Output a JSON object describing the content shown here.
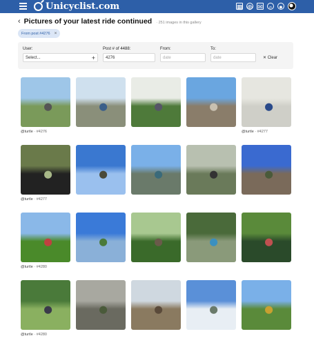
{
  "app": {
    "logo_text": "Unicyclist.com"
  },
  "header": {
    "title": "Pictures of your latest ride continued",
    "subtitle": "· 251 images in this gallery"
  },
  "chip": {
    "label": "From post #4276",
    "close": "×"
  },
  "filters": {
    "user_label": "User:",
    "user_value": "Select...",
    "post_label": "Post # of 4488:",
    "post_value": "4276",
    "from_label": "From:",
    "from_placeholder": "date",
    "to_label": "To:",
    "to_placeholder": "date",
    "clear_label": "Clear"
  },
  "icons": [
    "calendar-icon",
    "globe-icon",
    "mail-icon",
    "search-icon",
    "chat-icon"
  ],
  "gallery": [
    {
      "caption_user": "@turtle",
      "caption_post": "· #4276",
      "colors": [
        "#9ec6e8",
        "#7a9a5a",
        "#555"
      ]
    },
    {
      "caption_user": "",
      "caption_post": "",
      "colors": [
        "#cfe0ee",
        "#8a8f7a",
        "#3b5f8a"
      ]
    },
    {
      "caption_user": "",
      "caption_post": "",
      "colors": [
        "#e9ece6",
        "#4e7a3a",
        "#556"
      ]
    },
    {
      "caption_user": "",
      "caption_post": "",
      "colors": [
        "#6aa6e0",
        "#8a7d6a",
        "#c8c0b0"
      ]
    },
    {
      "caption_user": "@turtle",
      "caption_post": "· #4277",
      "colors": [
        "#e6e6e0",
        "#cfcfc8",
        "#2a4a8a"
      ]
    },
    {
      "caption_user": "@turtle",
      "caption_post": "· #4277",
      "colors": [
        "#6a7a4a",
        "#222",
        "#a8b888"
      ]
    },
    {
      "caption_user": "",
      "caption_post": "",
      "colors": [
        "#3a78d0",
        "#9ac0ee",
        "#4a4a3a"
      ]
    },
    {
      "caption_user": "",
      "caption_post": "",
      "colors": [
        "#7ab0e8",
        "#6a7a6a",
        "#3a6a7a"
      ]
    },
    {
      "caption_user": "",
      "caption_post": "",
      "colors": [
        "#b8c0b0",
        "#6a7a5a",
        "#333"
      ]
    },
    {
      "caption_user": "",
      "caption_post": "",
      "colors": [
        "#3a6ad0",
        "#7a6a5a",
        "#4a5a3a"
      ]
    },
    {
      "caption_user": "@turtle",
      "caption_post": "· #4280",
      "colors": [
        "#8ab8e8",
        "#4a8a2a",
        "#c04040"
      ]
    },
    {
      "caption_user": "",
      "caption_post": "",
      "colors": [
        "#3a7ad8",
        "#8ab0d8",
        "#4a7a3a"
      ]
    },
    {
      "caption_user": "",
      "caption_post": "",
      "colors": [
        "#a8c890",
        "#3a6a2a",
        "#6a5a4a"
      ]
    },
    {
      "caption_user": "",
      "caption_post": "",
      "colors": [
        "#4a6a3a",
        "#8a9a7a",
        "#3a90c0"
      ]
    },
    {
      "caption_user": "",
      "caption_post": "",
      "colors": [
        "#5a8a3a",
        "#2a4a2a",
        "#c05050"
      ]
    },
    {
      "caption_user": "@turtle",
      "caption_post": "· #4280",
      "colors": [
        "#4a7a3a",
        "#8ab060",
        "#3a3a4a"
      ]
    },
    {
      "caption_user": "",
      "caption_post": "",
      "colors": [
        "#a8a8a0",
        "#6a6a60",
        "#4a5a3a"
      ]
    },
    {
      "caption_user": "",
      "caption_post": "",
      "colors": [
        "#cfd8e0",
        "#8a7a60",
        "#5a4a3a"
      ]
    },
    {
      "caption_user": "",
      "caption_post": "",
      "colors": [
        "#5a90d8",
        "#e8eef4",
        "#6a7a6a"
      ]
    },
    {
      "caption_user": "",
      "caption_post": "",
      "colors": [
        "#7ab0e8",
        "#5a8a3a",
        "#c8a030"
      ]
    }
  ]
}
